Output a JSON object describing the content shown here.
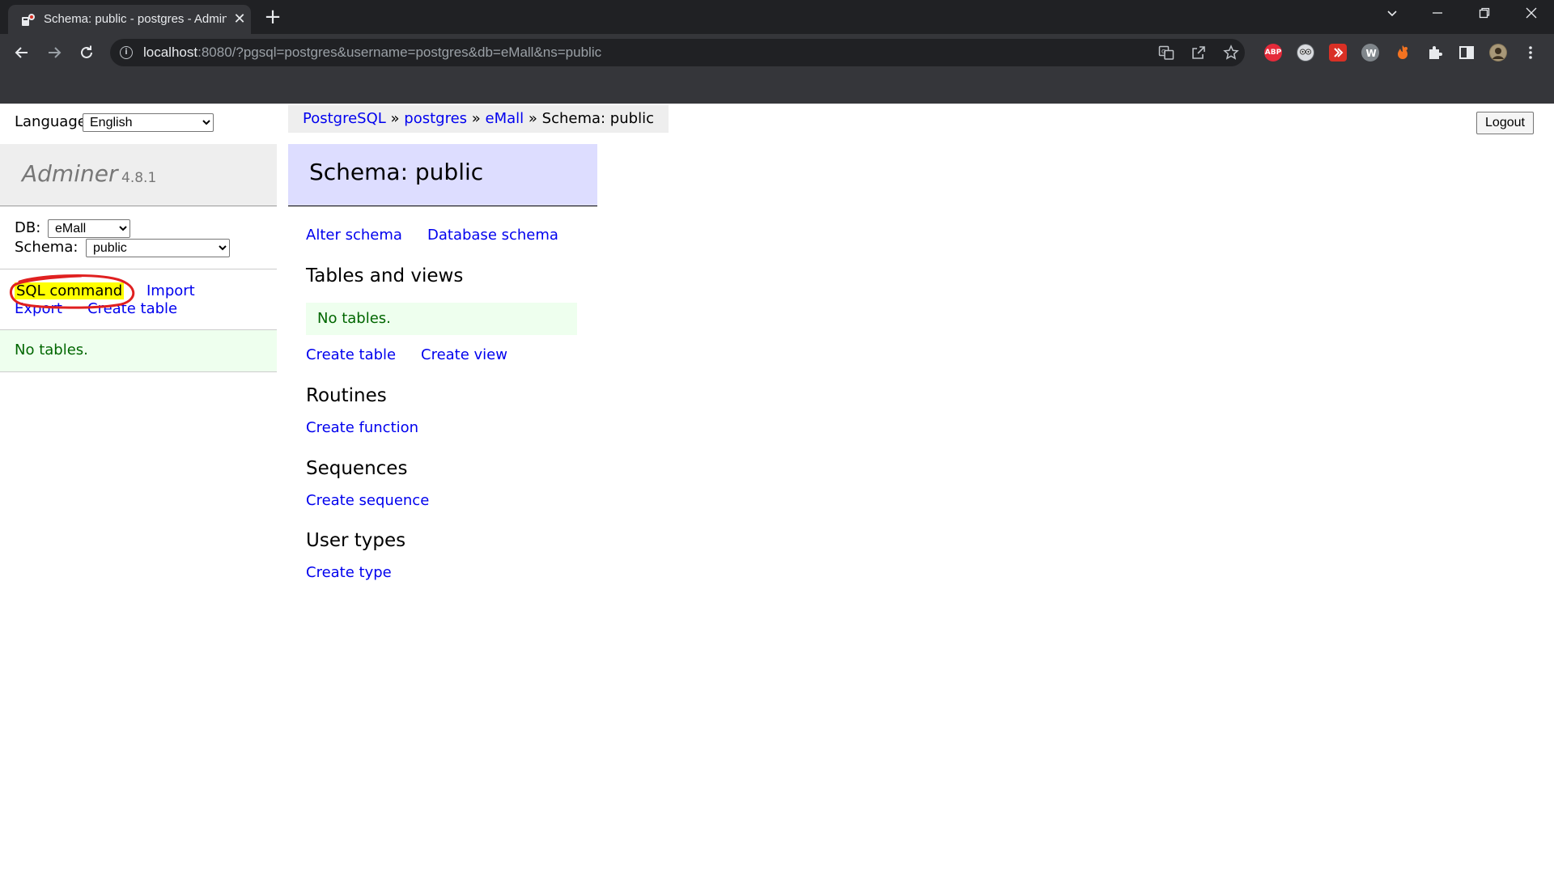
{
  "browser": {
    "tab_title": "Schema: public - postgres - Adminer",
    "tab_close": "✕",
    "new_tab": "+",
    "url_host": "localhost",
    "url_rest": ":8080/?pgsql=postgres&username=postgres&db=eMall&ns=public",
    "extensions": [
      "ABP"
    ]
  },
  "sidebar": {
    "language_label": "Language:",
    "language_value": "English",
    "app_name": "Adminer",
    "app_version": "4.8.1",
    "db_label": "DB:",
    "db_value": "eMall",
    "schema_label": "Schema:",
    "schema_value": "public",
    "links": {
      "sql_command": "SQL command",
      "import": "Import",
      "export": "Export",
      "create_table": "Create table"
    },
    "no_tables": "No tables."
  },
  "breadcrumb": {
    "items": [
      "PostgreSQL",
      "postgres",
      "eMall"
    ],
    "separator": "»",
    "current": "Schema: public"
  },
  "logout_label": "Logout",
  "main": {
    "title": "Schema: public",
    "alter_schema": "Alter schema",
    "database_schema": "Database schema",
    "tables_heading": "Tables and views",
    "no_tables": "No tables.",
    "create_table": "Create table",
    "create_view": "Create view",
    "routines_heading": "Routines",
    "create_function": "Create function",
    "sequences_heading": "Sequences",
    "create_sequence": "Create sequence",
    "user_types_heading": "User types",
    "create_type": "Create type"
  },
  "colors": {
    "link": "#0000ee",
    "highlight": "#ffff00",
    "annotation_ring": "#e02020",
    "success_bg": "#eeffee",
    "header_bg": "#ddddff"
  }
}
